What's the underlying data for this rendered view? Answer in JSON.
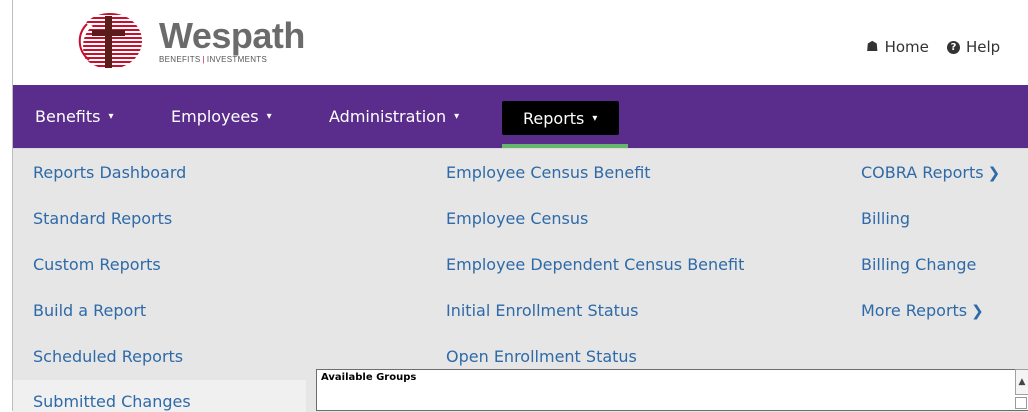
{
  "brand": {
    "name": "Wespath",
    "tagline_left": "BENEFITS",
    "tagline_sep": "|",
    "tagline_right": "INVESTMENTS"
  },
  "utility": {
    "home": {
      "icon": "home-icon",
      "label": "Home"
    },
    "help": {
      "icon": "question-circle-icon",
      "label": "Help"
    }
  },
  "nav": {
    "items": [
      {
        "label": "Benefits",
        "caret": "▾"
      },
      {
        "label": "Employees",
        "caret": "▾"
      },
      {
        "label": "Administration",
        "caret": "▾"
      },
      {
        "label": "Reports",
        "caret": "▾",
        "active": true
      }
    ]
  },
  "menu": {
    "col1": [
      "Reports Dashboard",
      "Standard Reports",
      "Custom Reports",
      "Build a Report",
      "Scheduled Reports",
      "Submitted Changes"
    ],
    "col2": [
      "Employee Census Benefit",
      "Employee Census",
      "Employee Dependent Census Benefit",
      "Initial Enrollment Status",
      "Open Enrollment Status"
    ],
    "col3": [
      {
        "label": "COBRA Reports",
        "chevron": "❯"
      },
      {
        "label": "Billing"
      },
      {
        "label": "Billing Change"
      },
      {
        "label": "More Reports",
        "chevron": "❯"
      }
    ]
  },
  "panel": {
    "title": "Available Groups",
    "scroll_up": "▲"
  },
  "colors": {
    "nav_bg": "#5a2d8c",
    "nav_active_bg": "#000000",
    "nav_active_underline": "#67b66d",
    "menu_bg": "#e6e6e6",
    "link": "#2e6aa8",
    "brand_red": "#c8102e"
  }
}
